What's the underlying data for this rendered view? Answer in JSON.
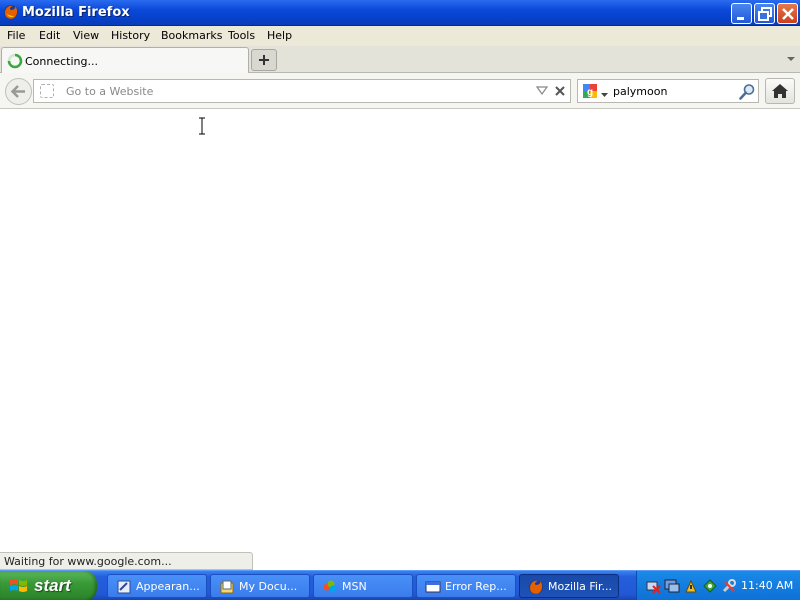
{
  "window": {
    "title": "Mozilla Firefox",
    "app_icon": "firefox-icon",
    "controls": [
      "minimize-icon",
      "restore-icon",
      "close-icon"
    ]
  },
  "menu": [
    "File",
    "Edit",
    "View",
    "History",
    "Bookmarks",
    "Tools",
    "Help"
  ],
  "tabs": [
    {
      "label": "Connecting...",
      "icon": "loading-spinner-icon",
      "active": true
    }
  ],
  "new_tab_icon": "plus-icon",
  "navbar": {
    "back_icon": "back-arrow-icon",
    "url_placeholder": "Go to a Website",
    "url_value": "",
    "search_engine_icon": "google-icon",
    "search_value": "palymoon",
    "search_icon": "magnifier-icon",
    "home_icon": "home-icon"
  },
  "status": "Waiting for www.google.com...",
  "taskbar": {
    "start_label": "start",
    "items": [
      {
        "label": "Appearan...",
        "icon": "appearance-icon",
        "active": false
      },
      {
        "label": "My Docu...",
        "icon": "documents-icon",
        "active": false
      },
      {
        "label": "MSN",
        "icon": "msn-icon",
        "active": false
      },
      {
        "label": "Error Rep...",
        "icon": "error-report-icon",
        "active": false
      },
      {
        "label": "Mozilla Fir...",
        "icon": "firefox-icon",
        "active": true
      }
    ],
    "tray_icons": [
      "network-x-icon",
      "monitor-icon",
      "security-icon",
      "update-icon",
      "tools-icon"
    ],
    "clock": "11:40 AM"
  },
  "colors": {
    "titlebar": "#0a48d8",
    "taskbar": "#245edb",
    "start": "#3a9a38",
    "tray": "#0e70d6"
  }
}
